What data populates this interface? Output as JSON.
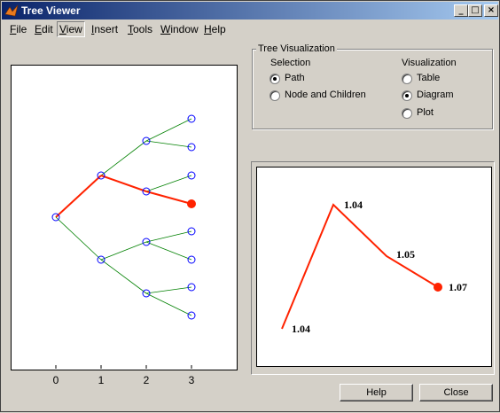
{
  "window": {
    "title": "Tree Viewer",
    "minimize": "_",
    "maximize": "□",
    "close": "×"
  },
  "menu": [
    {
      "label": "File",
      "key": "F",
      "rest": "ile"
    },
    {
      "label": "Edit",
      "key": "E",
      "rest": "dit"
    },
    {
      "label": "View",
      "key": "V",
      "rest": "iew"
    },
    {
      "label": "Insert",
      "key": "I",
      "rest": "nsert"
    },
    {
      "label": "Tools",
      "key": "T",
      "rest": "ools"
    },
    {
      "label": "Window",
      "key": "W",
      "rest": "indow"
    },
    {
      "label": "Help",
      "key": "H",
      "rest": "elp"
    }
  ],
  "tree_axis": {
    "xticks": [
      "0",
      "1",
      "2",
      "3"
    ]
  },
  "tree_visualization": {
    "title": "Tree Visualization",
    "selection": {
      "label": "Selection",
      "options": [
        "Path",
        "Node and Children"
      ],
      "selected": "Path"
    },
    "visualization": {
      "label": "Visualization",
      "options": [
        "Table",
        "Diagram",
        "Plot"
      ],
      "selected": "Diagram"
    }
  },
  "diagram": {
    "path_values": [
      "1.04",
      "1.04",
      "1.05",
      "1.07"
    ],
    "colors": {
      "path": "#ff2200",
      "edge": "#008000",
      "node": "#0000ff"
    }
  },
  "buttons": {
    "help": "Help",
    "close": "Close"
  }
}
